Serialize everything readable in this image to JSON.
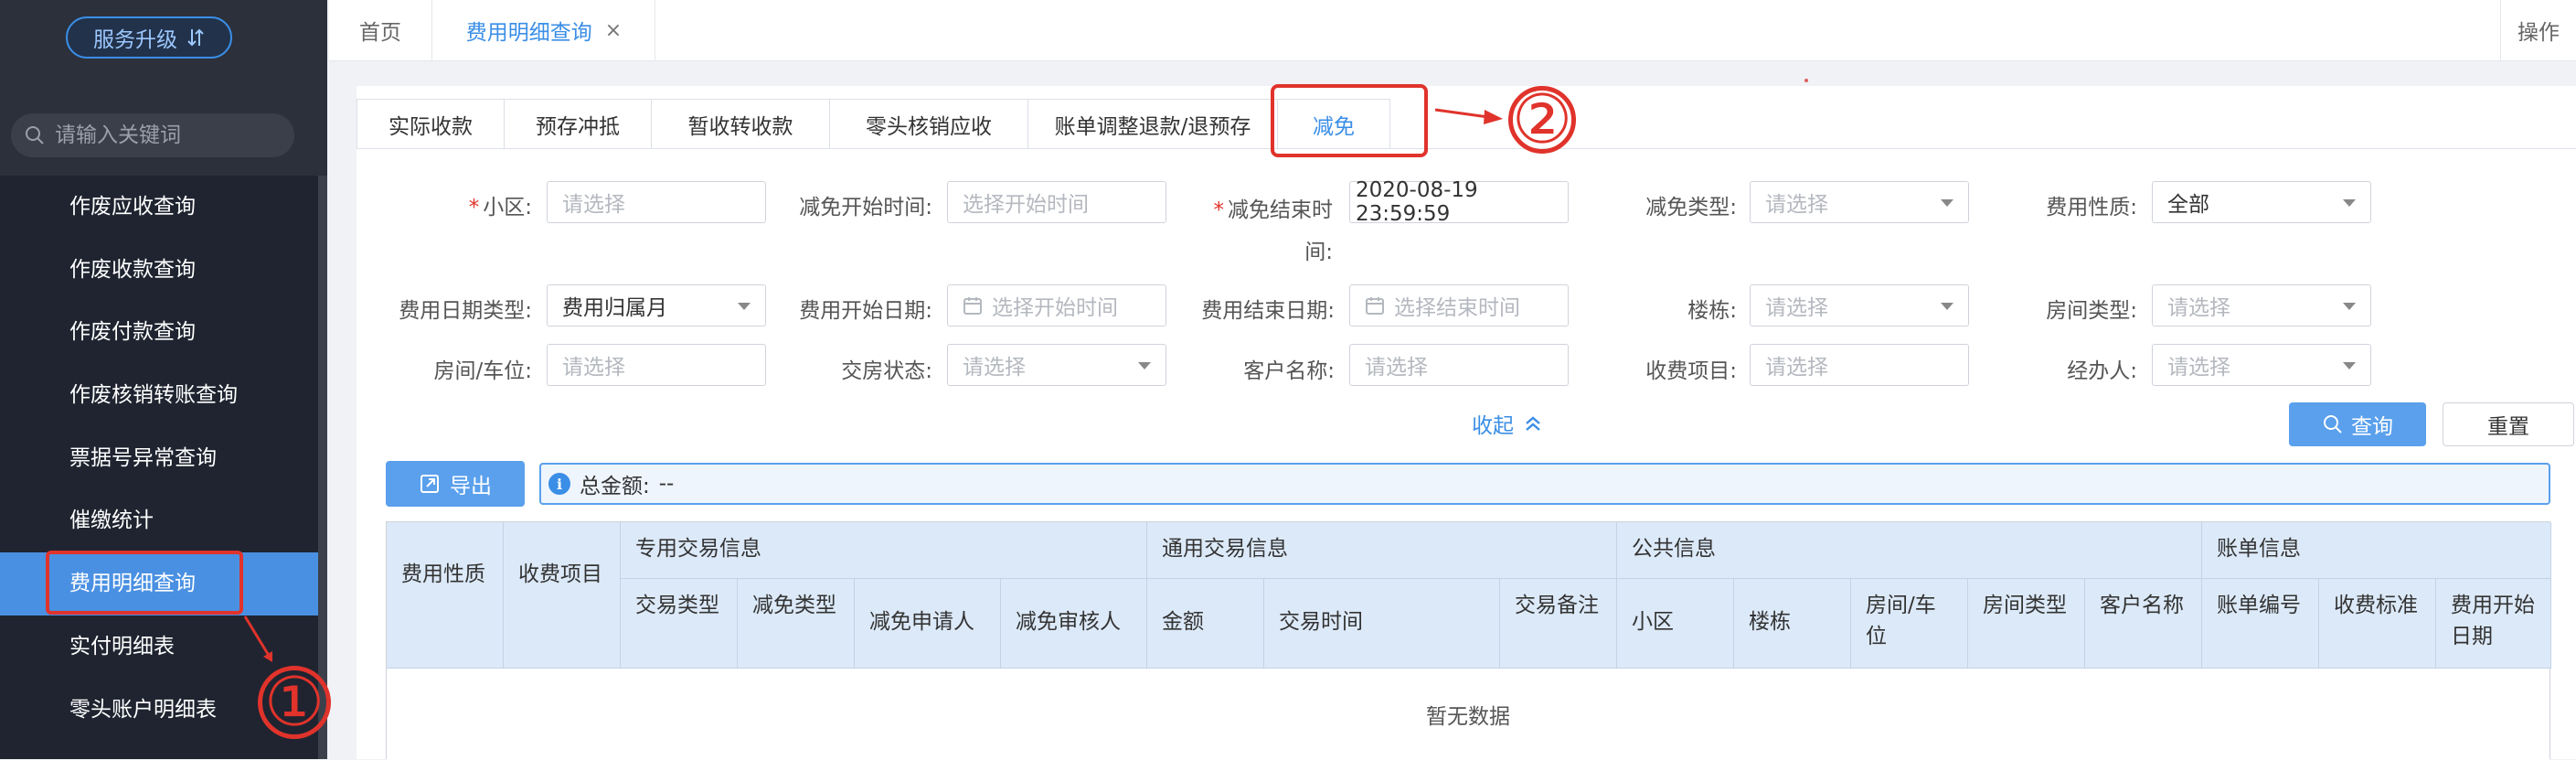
{
  "sidebar": {
    "upgrade_label": "服务升级",
    "upgrade_icon": "sort-arrows-icon",
    "search_placeholder": "请输入关键词",
    "menu": [
      {
        "label": "作废应收查询",
        "active": false
      },
      {
        "label": "作废收款查询",
        "active": false
      },
      {
        "label": "作废付款查询",
        "active": false
      },
      {
        "label": "作废核销转账查询",
        "active": false
      },
      {
        "label": "票据号异常查询",
        "active": false
      },
      {
        "label": "催缴统计",
        "active": false
      },
      {
        "label": "费用明细查询",
        "active": true
      },
      {
        "label": "实付明细表",
        "active": false
      },
      {
        "label": "零头账户明细表",
        "active": false
      }
    ]
  },
  "annotations": {
    "one": "①",
    "two": "②",
    "color": "#e0332b"
  },
  "topbar": {
    "home_tab": "首页",
    "current_tab": "费用明细查询",
    "close_glyph": "×",
    "ops_label": "操作"
  },
  "subtabs": [
    "实际收款",
    "预存冲抵",
    "暂收转收款",
    "零头核销应收",
    "账单调整退款/退预存",
    "减免"
  ],
  "active_subtab": "减免",
  "filters": {
    "community": {
      "label": "小区:",
      "required": "*",
      "placeholder": "请选择"
    },
    "waive_start": {
      "label": "减免开始时间:",
      "placeholder": "选择开始时间"
    },
    "waive_end": {
      "label_line1": "减免结束时",
      "label_line2": "间:",
      "required": "*",
      "value": "2020-08-19 23:59:59"
    },
    "waive_type": {
      "label": "减免类型:",
      "placeholder": "请选择"
    },
    "fee_nature": {
      "label": "费用性质:",
      "value": "全部"
    },
    "fee_date_type": {
      "label": "费用日期类型:",
      "value": "费用归属月"
    },
    "fee_start_date": {
      "label": "费用开始日期:",
      "placeholder": "选择开始时间"
    },
    "fee_end_date": {
      "label": "费用结束日期:",
      "placeholder": "选择结束时间"
    },
    "building": {
      "label": "楼栋:",
      "placeholder": "请选择"
    },
    "room_type": {
      "label": "房间类型:",
      "placeholder": "请选择"
    },
    "room": {
      "label": "房间/车位:",
      "placeholder": "请选择"
    },
    "handover": {
      "label": "交房状态:",
      "placeholder": "请选择"
    },
    "customer": {
      "label": "客户名称:",
      "placeholder": "请选择"
    },
    "fee_item": {
      "label": "收费项目:",
      "placeholder": "请选择"
    },
    "handler": {
      "label": "经办人:",
      "placeholder": "请选择"
    }
  },
  "actions": {
    "collapse": "收起",
    "query": "查询",
    "reset": "重置",
    "export": "导出"
  },
  "summary": {
    "label": "总金额:",
    "value": "--"
  },
  "table": {
    "groups": [
      "专用交易信息",
      "通用交易信息",
      "公共信息",
      "账单信息"
    ],
    "columns": {
      "fee_nature": "费用性质",
      "fee_item": "收费项目",
      "trade_type": "交易类型",
      "waive_type": "减免类型",
      "applicant": "减免申请人",
      "reviewer": "减免审核人",
      "amount": "金额",
      "trade_time": "交易时间",
      "trade_note": "交易备注",
      "community": "小区",
      "building": "楼栋",
      "room": "房间/车位",
      "room_type": "房间类型",
      "customer": "客户名称",
      "bill_no": "账单编号",
      "standard": "收费标准",
      "fee_start": "费用开始日期"
    },
    "empty_text": "暂无数据"
  }
}
